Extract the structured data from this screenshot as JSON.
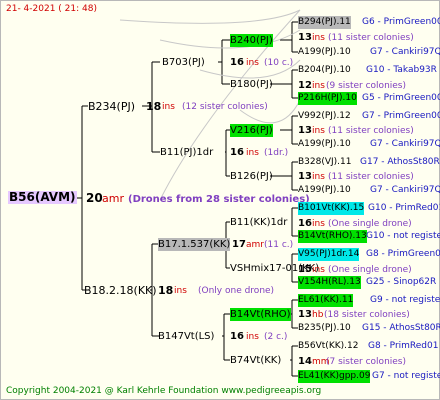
{
  "header": {
    "date": "21-   4-2021  ( 21:  48)"
  },
  "footer": {
    "copyright": "Copyright 2004-2021 @ Karl Kehrle Foundation   www.pedigreeapis.org"
  },
  "root": {
    "name": "B56(AVM)",
    "num": "20",
    "code": "amr",
    "note": "(Drones from 28 sister colonies)"
  },
  "gen1": [
    {
      "name": "B234(PJ)",
      "num": "18",
      "code": "ins",
      "note": "(12 sister colonies)"
    },
    {
      "name": "B18.2.18(KK)",
      "num": "18",
      "code": "ins",
      "note": "(Only one drone)"
    }
  ],
  "gen2": [
    {
      "name": "B703(PJ)",
      "num": "16",
      "code": "ins",
      "note": "(10 c.)"
    },
    {
      "name": "B11(PJ)1dr",
      "num": "16",
      "code": "ins",
      "note": "(1dr.)"
    },
    {
      "name": "B17.1.537(KK)",
      "num": "17",
      "code": "amr",
      "note": "(11 c.)"
    },
    {
      "name": "B147Vt(LS)",
      "num": "16",
      "code": "ins",
      "note": "(2 c.)"
    }
  ],
  "gen3": [
    {
      "name": "B240(PJ)"
    },
    {
      "name": "B180(PJ)"
    },
    {
      "name": "V216(PJ)"
    },
    {
      "name": "B126(PJ)"
    },
    {
      "name": "B11(KK)1dr",
      "num": "16",
      "code": "ins",
      "note": "(One single drone)"
    },
    {
      "name": "VSHmix17-01(KK)",
      "num": "15",
      "code": "ins",
      "note": "(One single drone)"
    },
    {
      "name": "B14Vt(RHO)",
      "num": "16",
      "code": "ins",
      "note": "(2 c.)"
    },
    {
      "name": "B74Vt(KK)",
      "num": "14",
      "code": "mm",
      "note": "(7 sister colonies)"
    }
  ],
  "gen4": [
    {
      "name": "B294(PJ).11",
      "info": "G6 - PrimGreen00"
    },
    {
      "num": "13",
      "code": "ins",
      "note": "(11 sister colonies)"
    },
    {
      "name": "A199(PJ).10",
      "info": "G7 - Cankiri97Q"
    },
    {
      "name": "B204(PJ).10",
      "info": "G10 - Takab93R"
    },
    {
      "num": "12",
      "code": "ins",
      "note": "(9 sister colonies)"
    },
    {
      "name": "P216H(PJ).10",
      "info": "G5 - PrimGreen00"
    },
    {
      "name": "V992(PJ).12",
      "info": "G7 - PrimGreen00"
    },
    {
      "num": "13",
      "code": "ins",
      "note": "(11 sister colonies)"
    },
    {
      "name": "A199(PJ).10",
      "info": "G7 - Cankiri97Q"
    },
    {
      "name": "B328(VJ).11",
      "info": "G17 - AthosSt80R"
    },
    {
      "num": "13",
      "code": "ins",
      "note": "(11 sister colonies)"
    },
    {
      "name": "A199(PJ).10",
      "info": "G7 - Cankiri97Q"
    },
    {
      "name": "B101Vt(KK).15",
      "info": "G10 - PrimRed01"
    },
    {
      "name": "B14Vt(RHO).13",
      "info": "G10 - not registe"
    },
    {
      "name": "V95(PJ)1dr.14",
      "info": "G8 - PrimGreen00"
    },
    {
      "name": "V154H(RL).13",
      "info": "G25 - Sinop62R"
    },
    {
      "name": "EL61(KK).11",
      "info": "G9 - not registe"
    },
    {
      "num": "13",
      "code": "hb",
      "note": "(18 sister colonies)"
    },
    {
      "name": "B235(PJ).10",
      "info": "G15 - AthosSt80R"
    },
    {
      "name": "B56Vt(KK).12",
      "info": "G8 - PrimRed01"
    },
    {
      "name": "EL41(KK)gpp.09",
      "info": "G7 - not registe"
    }
  ]
}
